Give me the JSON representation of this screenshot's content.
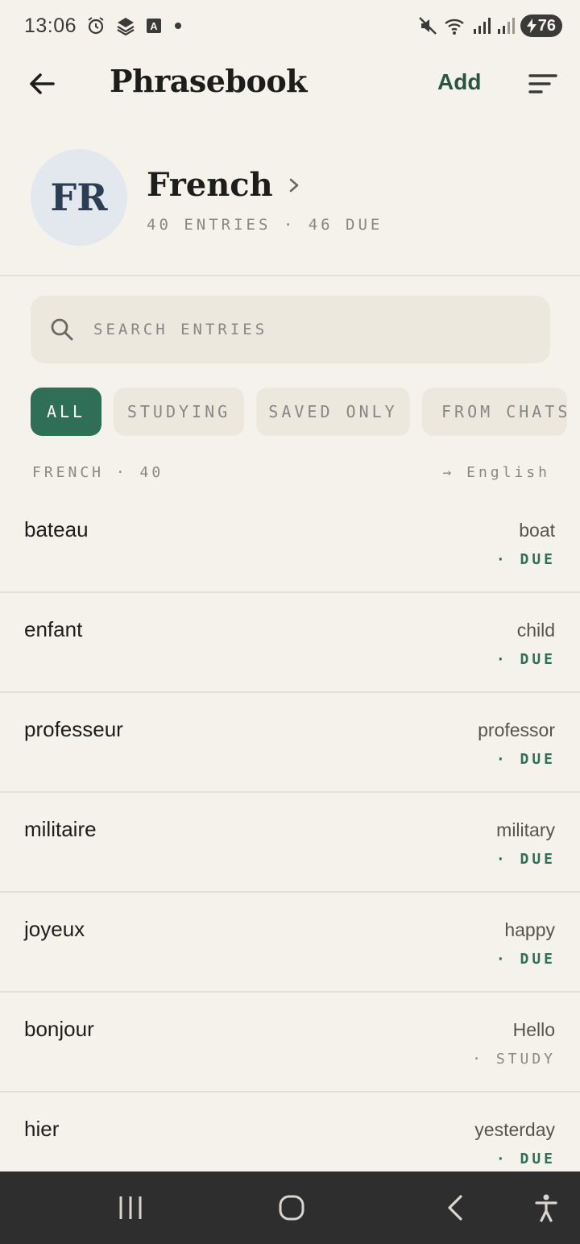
{
  "status_bar": {
    "time": "13:06",
    "battery": "76"
  },
  "appbar": {
    "title": "Phrasebook",
    "add_label": "Add"
  },
  "language": {
    "code": "FR",
    "name": "French",
    "meta": "40 ENTRIES · 46 DUE"
  },
  "search": {
    "placeholder": "SEARCH ENTRIES"
  },
  "filters": [
    {
      "label": "ALL",
      "active": true
    },
    {
      "label": "STUDYING",
      "active": false
    },
    {
      "label": "SAVED ONLY",
      "active": false
    },
    {
      "label": "FROM CHATS",
      "active": false
    }
  ],
  "list_header": {
    "left": "FRENCH · 40",
    "right": "→ English"
  },
  "entries": [
    {
      "word": "bateau",
      "translation": "boat",
      "status": "· DUE",
      "status_type": "due"
    },
    {
      "word": "enfant",
      "translation": "child",
      "status": "· DUE",
      "status_type": "due"
    },
    {
      "word": "professeur",
      "translation": "professor",
      "status": "· DUE",
      "status_type": "due"
    },
    {
      "word": "militaire",
      "translation": "military",
      "status": "· DUE",
      "status_type": "due"
    },
    {
      "word": "joyeux",
      "translation": "happy",
      "status": "· DUE",
      "status_type": "due"
    },
    {
      "word": "bonjour",
      "translation": "Hello",
      "status": "· STUDY",
      "status_type": "study"
    },
    {
      "word": "hier",
      "translation": "yesterday",
      "status": "· DUE",
      "status_type": "due"
    }
  ],
  "colors": {
    "accent": "#2f6f58",
    "background": "#f5f2ec",
    "chip": "#ece8dd"
  },
  "icons": [
    "alarm-icon",
    "layers-icon",
    "a-box-icon",
    "mute-icon",
    "wifi-icon",
    "signal-icon",
    "back-arrow-icon",
    "sort-icon",
    "chevron-right-icon",
    "search-icon",
    "recents-icon",
    "home-icon",
    "nav-back-icon",
    "accessibility-icon"
  ]
}
